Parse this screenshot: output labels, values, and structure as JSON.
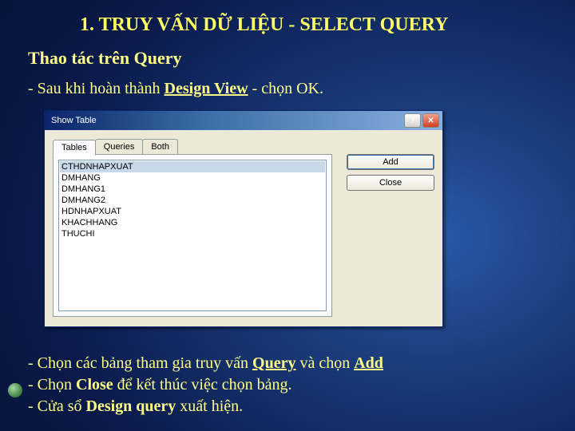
{
  "title": "1. TRUY VẤN DỮ LIỆU - SELECT QUERY",
  "subtitle": "Thao tác trên Query",
  "line1_pre": "- Sau khi hoàn thành ",
  "line1_u": "Design View",
  "line1_post": " - chọn  OK.",
  "bottom": {
    "l1_a": "- Chọn các bảng tham gia truy vấn ",
    "l1_b": "Query",
    "l1_c": " và chọn ",
    "l1_d": "Add",
    "l2_a": "- Chọn ",
    "l2_b": "Close",
    "l2_c": " để kết thúc việc chọn bảng.",
    "l3_a": "- Cửa sổ ",
    "l3_b": "Design query",
    "l3_c": " xuất hiện."
  },
  "dialog": {
    "title": "Show Table",
    "help": "?",
    "close": "✕",
    "tabs": {
      "tables": "Tables",
      "queries": "Queries",
      "both": "Both"
    },
    "buttons": {
      "add": "Add",
      "close": "Close"
    },
    "items": [
      "CTHDNHAPXUAT",
      "DMHANG",
      "DMHANG1",
      "DMHANG2",
      "HDNHAPXUAT",
      "KHACHHANG",
      "THUCHI"
    ]
  }
}
